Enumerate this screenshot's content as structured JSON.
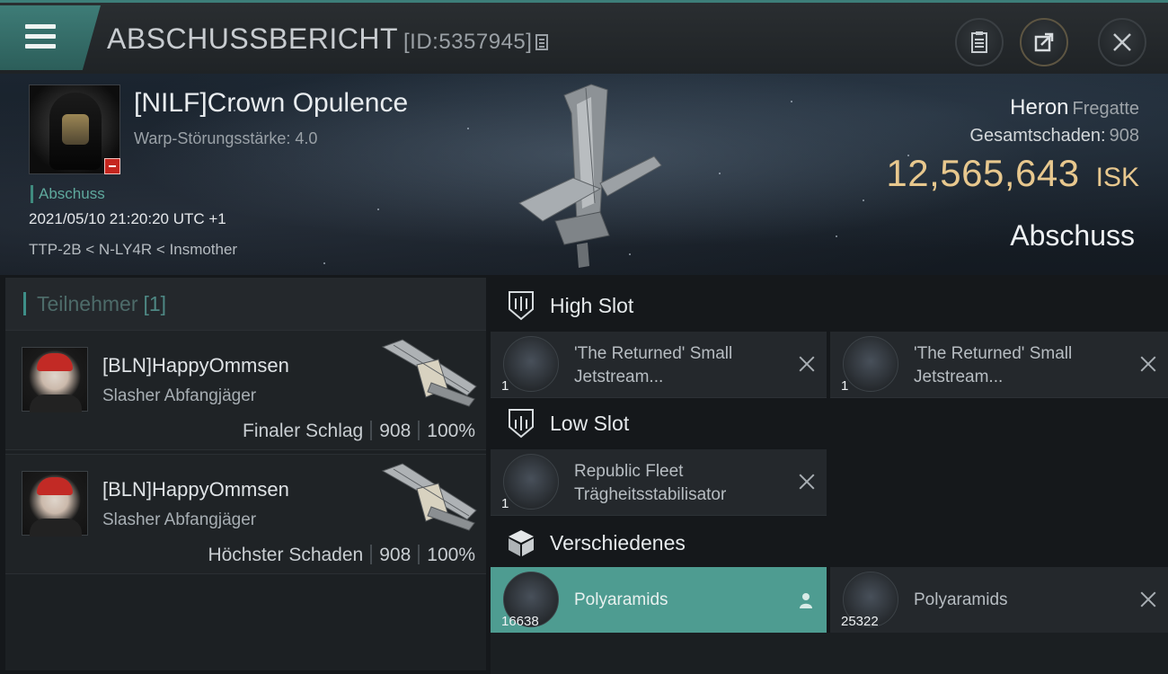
{
  "header": {
    "title": "ABSCHUSSBERICHT",
    "id_label": "[ID:5357945]"
  },
  "victim": {
    "name": "[NILF]Crown Opulence",
    "warp_strength": "Warp-Störungsstärke: 4.0",
    "tag": "Abschuss",
    "datetime": "2021/05/10 21:20:20 UTC +1",
    "location": "TTP-2B < N-LY4R < Insmother",
    "ship_name": "Heron",
    "ship_class": "Fregatte",
    "damage_label": "Gesamtschaden:",
    "damage_value": "908",
    "isk_value": "12,565,643",
    "isk_unit": "ISK",
    "kill_type": "Abschuss"
  },
  "participants": {
    "title": "Teilnehmer",
    "count": "[1]",
    "rows": [
      {
        "name": "[BLN]HappyOmmsen",
        "ship": "Slasher Abfangjäger",
        "role": "Finaler Schlag",
        "damage": "908",
        "percent": "100%"
      },
      {
        "name": "[BLN]HappyOmmsen",
        "ship": "Slasher Abfangjäger",
        "role": "Höchster Schaden",
        "damage": "908",
        "percent": "100%"
      }
    ]
  },
  "fitting": {
    "high_slot": {
      "title": "High Slot",
      "items": [
        {
          "name": "'The Returned' Small\nJetstream...",
          "qty": "1"
        },
        {
          "name": "'The Returned' Small\nJetstream...",
          "qty": "1"
        }
      ]
    },
    "low_slot": {
      "title": "Low Slot",
      "items": [
        {
          "name": "Republic Fleet\nTrägheitsstabilisator",
          "qty": "1"
        }
      ]
    },
    "misc": {
      "title": "Verschiedenes",
      "items": [
        {
          "name": "Polyaramids",
          "qty": "16638",
          "dropped": true
        },
        {
          "name": "Polyaramids",
          "qty": "25322",
          "dropped": false
        }
      ]
    }
  },
  "icons": {
    "menu": "hamburger-menu-icon",
    "copy": "copy-icon",
    "report": "clipboard-icon",
    "share": "share-icon",
    "close": "close-icon",
    "high_slot": "high-slot-icon",
    "low_slot": "low-slot-icon",
    "misc": "cargo-box-icon"
  },
  "colors": {
    "accent": "#3e8f88",
    "isk": "#e8c88e",
    "dropped_highlight": "#4e9c91",
    "victim_badge": "#c5261f"
  }
}
